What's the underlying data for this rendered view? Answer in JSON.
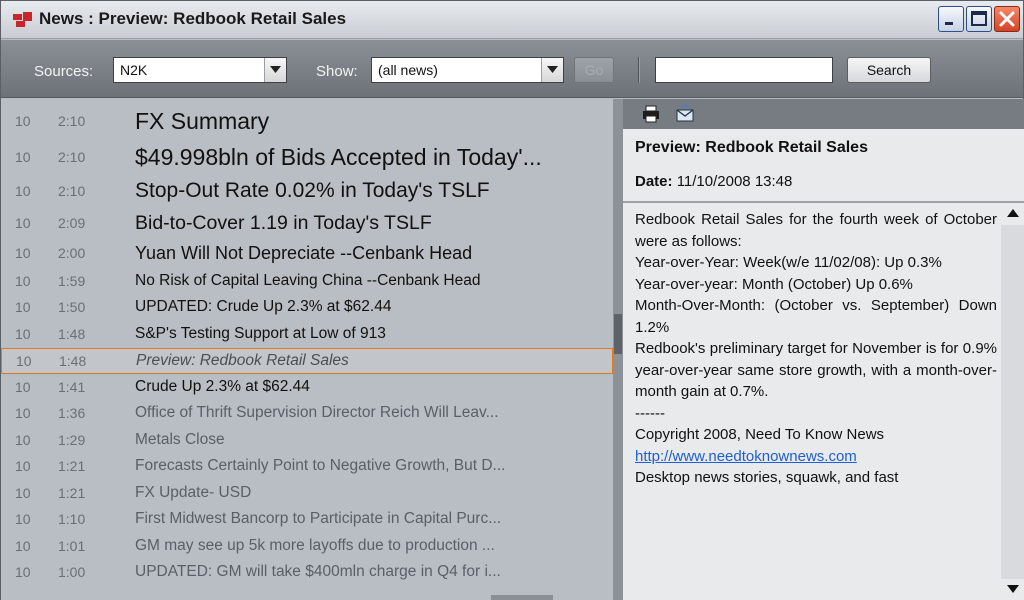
{
  "window": {
    "title": "News : Preview: Redbook Retail Sales"
  },
  "toolbar": {
    "sources_label": "Sources:",
    "sources_value": "N2K",
    "show_label": "Show:",
    "show_value": "(all news)",
    "go_label": "Go",
    "search_value": "",
    "search_label": "Search"
  },
  "news": [
    {
      "day": "10",
      "time": "2:10",
      "headline": "FX Summary",
      "size": "xl",
      "read": false
    },
    {
      "day": "10",
      "time": "2:10",
      "headline": "$49.998bln of Bids Accepted in Today'...",
      "size": "xl",
      "read": false
    },
    {
      "day": "10",
      "time": "2:10",
      "headline": "Stop-Out Rate 0.02% in Today's TSLF",
      "size": "lg",
      "read": false
    },
    {
      "day": "10",
      "time": "2:09",
      "headline": "Bid-to-Cover 1.19 in Today's TSLF",
      "size": "md",
      "read": false
    },
    {
      "day": "10",
      "time": "2:00",
      "headline": "Yuan Will Not Depreciate --Cenbank Head",
      "size": "md2",
      "read": false
    },
    {
      "day": "10",
      "time": "1:59",
      "headline": "No Risk of Capital Leaving China --Cenbank Head",
      "size": "sm",
      "read": false
    },
    {
      "day": "10",
      "time": "1:50",
      "headline": "UPDATED: Crude Up 2.3% at $62.44",
      "size": "sm",
      "read": false
    },
    {
      "day": "10",
      "time": "1:48",
      "headline": "S&P's Testing Support at Low of 913",
      "size": "sm",
      "read": false
    },
    {
      "day": "10",
      "time": "1:48",
      "headline": "Preview: Redbook Retail Sales",
      "size": "sm",
      "read": true,
      "selected": true
    },
    {
      "day": "10",
      "time": "1:41",
      "headline": "Crude Up 2.3% at $62.44",
      "size": "sm",
      "read": false
    },
    {
      "day": "10",
      "time": "1:36",
      "headline": "Office of Thrift Supervision Director Reich Will Leav...",
      "size": "sm",
      "read": true
    },
    {
      "day": "10",
      "time": "1:29",
      "headline": "Metals Close",
      "size": "sm",
      "read": true
    },
    {
      "day": "10",
      "time": "1:21",
      "headline": "Forecasts Certainly Point to Negative Growth, But D...",
      "size": "sm",
      "read": true
    },
    {
      "day": "10",
      "time": "1:21",
      "headline": "FX Update- USD",
      "size": "sm",
      "read": true
    },
    {
      "day": "10",
      "time": "1:10",
      "headline": "First Midwest Bancorp to Participate in Capital Purc...",
      "size": "sm",
      "read": true
    },
    {
      "day": "10",
      "time": "1:01",
      "headline": "GM may see up 5k more layoffs due to production ...",
      "size": "sm",
      "read": true
    },
    {
      "day": "10",
      "time": "1:00",
      "headline": "UPDATED: GM will take $400mln charge in Q4 for i...",
      "size": "sm",
      "read": true
    }
  ],
  "preview": {
    "title": "Preview: Redbook Retail Sales",
    "date_label": "Date:",
    "date_value": "11/10/2008 13:48",
    "body": [
      "Redbook Retail Sales for the fourth week of October were as follows:",
      "Year-over-Year: Week(w/e 11/02/08): Up 0.3%",
      "Year-over-year:  Month  (October)  Up 0.6%",
      "Month-Over-Month:  (October  vs. September) Down 1.2%",
      "Redbook's preliminary target for November is for 0.9% year-over-year same store growth, with a month-over-month gain at 0.7%.",
      "------",
      "Copyright 2008, Need To Know News"
    ],
    "link": "http://www.needtoknownews.com",
    "body_tail": "Desktop news stories, squawk, and fast"
  },
  "colors": {
    "selection_border": "#e07a1f",
    "link": "#1f5fd0"
  }
}
